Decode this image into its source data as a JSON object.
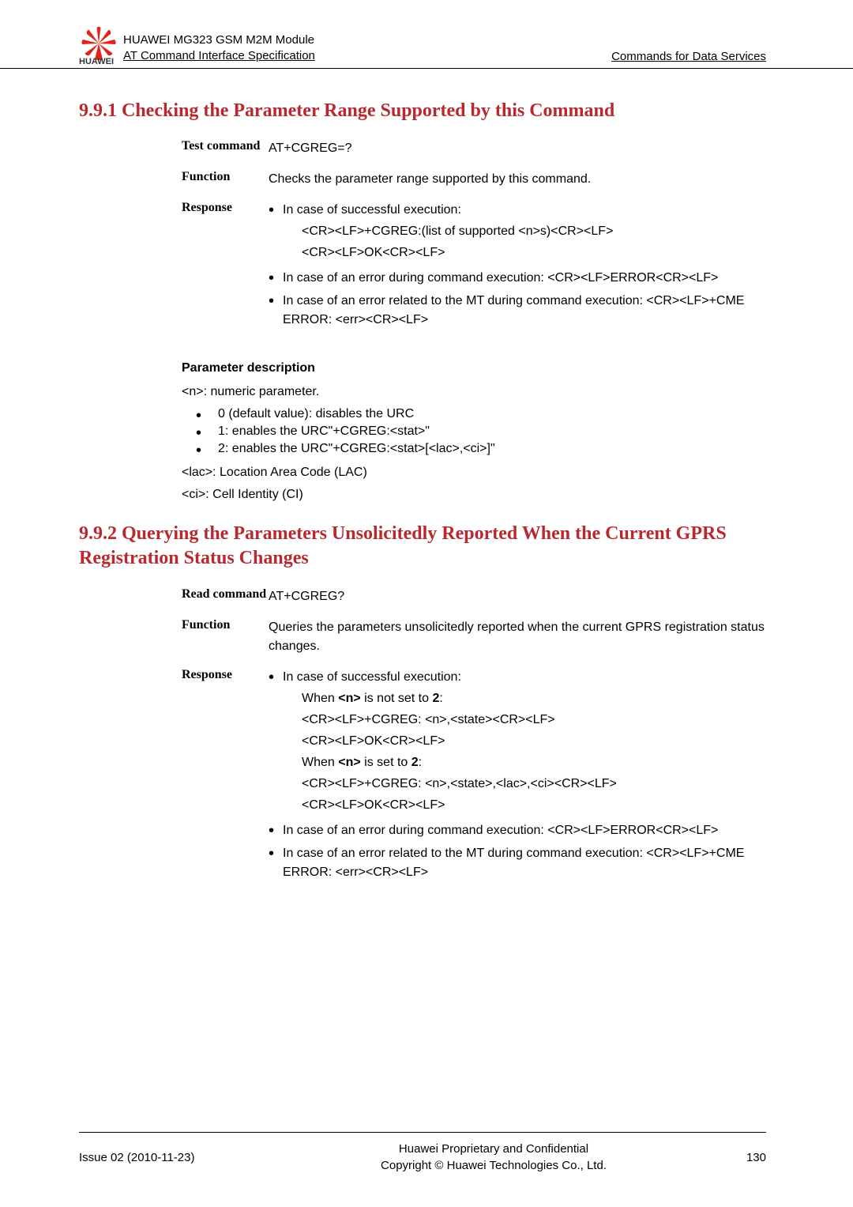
{
  "header": {
    "line1": "HUAWEI MG323 GSM M2M Module",
    "line2": "AT Command Interface Specification",
    "brand": "HUAWEI",
    "right": "Commands for Data Services"
  },
  "section991": {
    "title": "9.9.1 Checking the Parameter Range Supported by this Command",
    "rows": {
      "test_label": "Test command",
      "test_value": "AT+CGREG=?",
      "function_label": "Function",
      "function_value": "Checks the parameter range supported by this command.",
      "response_label": "Response",
      "resp1": "In case of successful execution:",
      "resp1a": "<CR><LF>+CGREG:(list of supported <n>s)<CR><LF>",
      "resp1b": "<CR><LF>OK<CR><LF>",
      "resp2": "In case of an error during command execution: <CR><LF>ERROR<CR><LF>",
      "resp3": "In case of an error related to the MT during command execution: <CR><LF>+CME ERROR: <err><CR><LF>"
    },
    "param_title": "Parameter description",
    "param_n": "<n>: numeric parameter.",
    "param_list": [
      "0 (default value): disables the URC",
      "1: enables the URC\"+CGREG:<stat>\"",
      "2: enables the URC\"+CGREG:<stat>[<lac>,<ci>]\""
    ],
    "param_lac": "<lac>: Location Area Code (LAC)",
    "param_ci": "<ci>: Cell Identity (CI)"
  },
  "section992": {
    "title": "9.9.2 Querying the Parameters Unsolicitedly Reported When the Current GPRS Registration Status Changes",
    "rows": {
      "read_label": "Read command",
      "read_value": "AT+CGREG?",
      "function_label": "Function",
      "function_value": "Queries the parameters unsolicitedly reported when the current GPRS registration status changes.",
      "response_label": "Response",
      "resp1": "In case of successful execution:",
      "when1": "When <n> is not set to 2:",
      "line1a": "<CR><LF>+CGREG: <n>,<state><CR><LF>",
      "line1b": "<CR><LF>OK<CR><LF>",
      "when2": "When <n> is set to 2:",
      "line2a": "<CR><LF>+CGREG: <n>,<state>,<lac>,<ci><CR><LF>",
      "line2b": "<CR><LF>OK<CR><LF>",
      "resp2": "In case of an error during command execution: <CR><LF>ERROR<CR><LF>",
      "resp3": "In case of an error related to the MT during command execution: <CR><LF>+CME ERROR: <err><CR><LF>"
    }
  },
  "footer": {
    "left": "Issue 02 (2010-11-23)",
    "center1": "Huawei Proprietary and Confidential",
    "center2": "Copyright © Huawei Technologies Co., Ltd.",
    "right": "130"
  }
}
